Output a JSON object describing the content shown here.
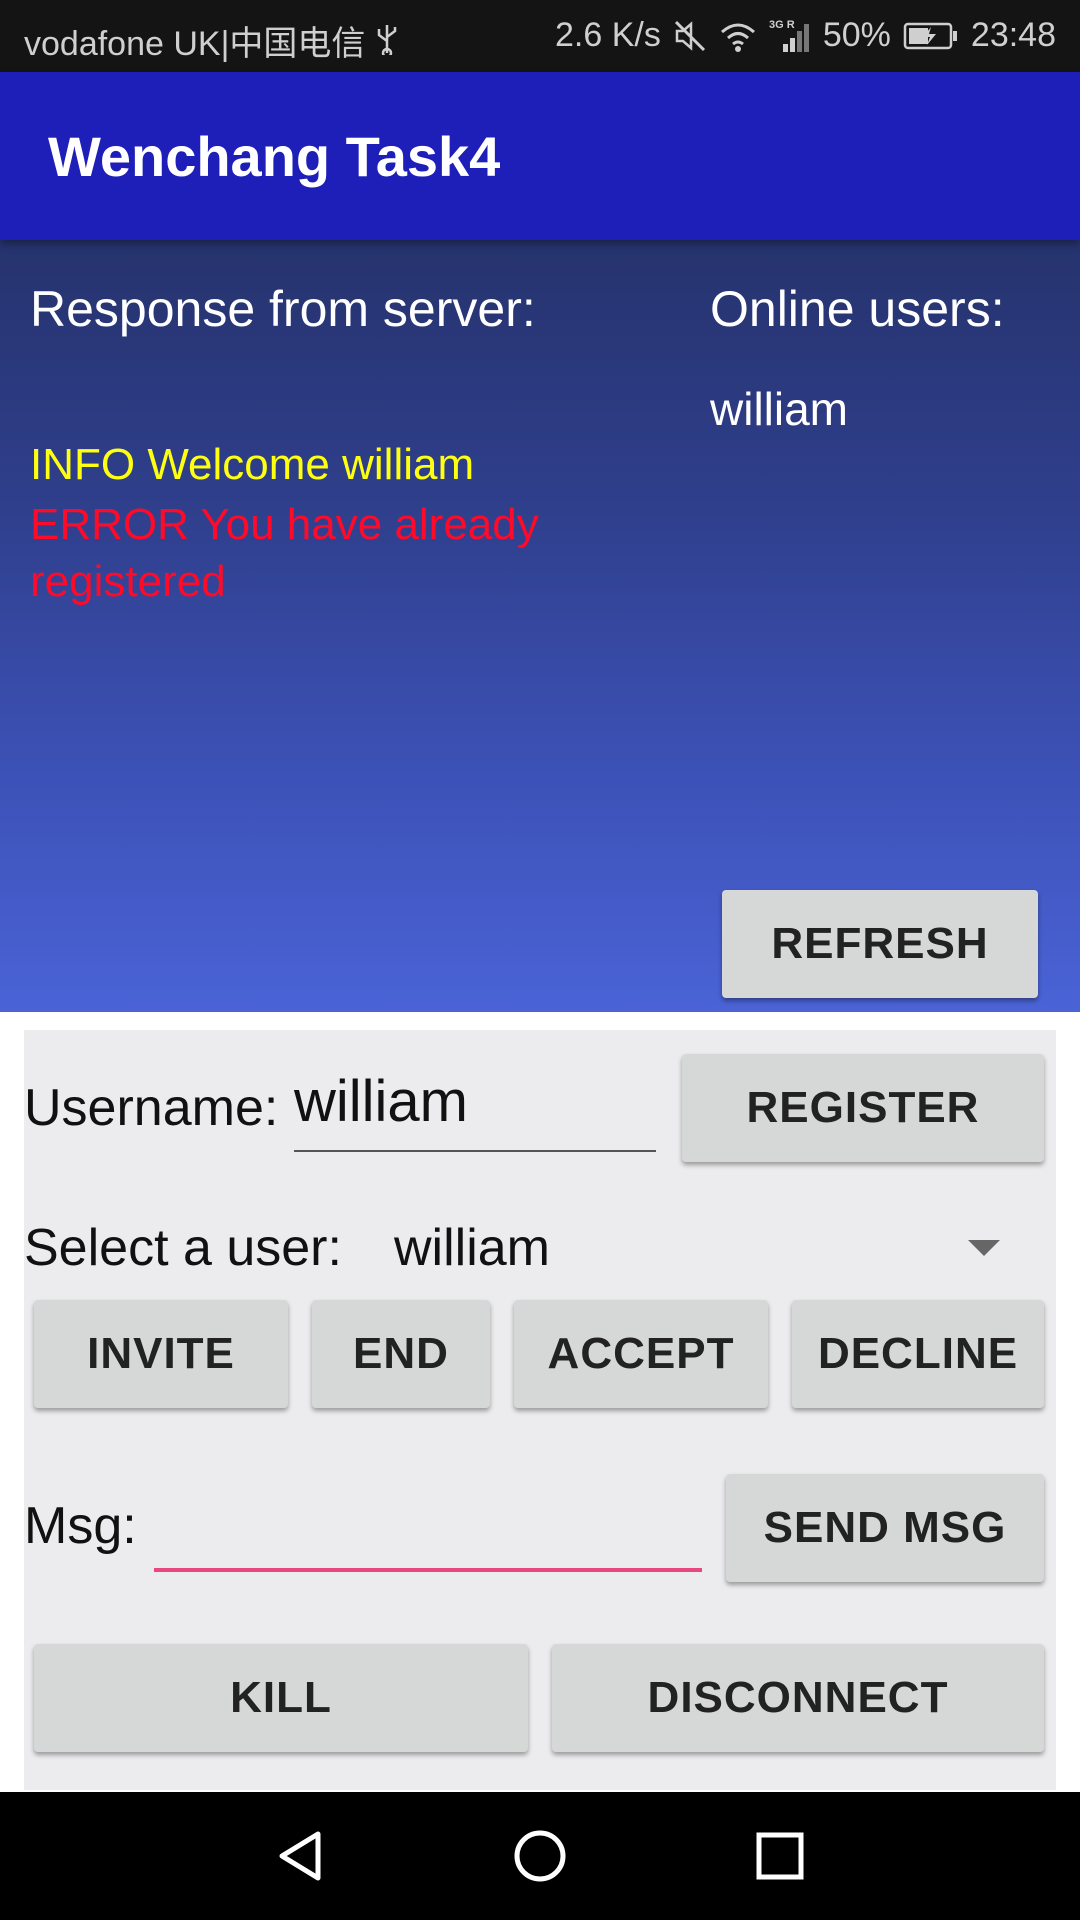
{
  "status_bar": {
    "carrier": "vodafone UK|中国电信",
    "speed": "2.6 K/s",
    "network": "3G R",
    "battery": "50%",
    "time": "23:48"
  },
  "app_bar": {
    "title": "Wenchang Task4"
  },
  "server_panel": {
    "response_title": "Response from server:",
    "info_message": "INFO Welcome william",
    "error_message": "ERROR You have already registered",
    "online_title": "Online users:",
    "online_users": [
      "william"
    ],
    "refresh_label": "REFRESH"
  },
  "form": {
    "username_label": "Username:",
    "username_value": "william",
    "register_label": "REGISTER",
    "select_label": "Select a user:",
    "selected_user": "william",
    "invite_label": "INVITE",
    "end_label": "END",
    "accept_label": "ACCEPT",
    "decline_label": "DECLINE",
    "msg_label": "Msg:",
    "msg_value": "",
    "send_label": "SEND MSG",
    "kill_label": "KILL",
    "disconnect_label": "DISCONNECT"
  },
  "colors": {
    "app_bar": "#1e1eb9",
    "info_text": "#ffff10",
    "error_text": "#ff0a28",
    "focus_underline": "#e8487e"
  },
  "icons": {
    "usb": "usb-icon",
    "mute": "mute-icon",
    "wifi": "wifi-icon",
    "signal": "signal-icon",
    "battery": "battery-icon",
    "nav_back": "back-icon",
    "nav_home": "home-icon",
    "nav_recents": "recents-icon",
    "spinner": "dropdown-arrow-icon"
  }
}
